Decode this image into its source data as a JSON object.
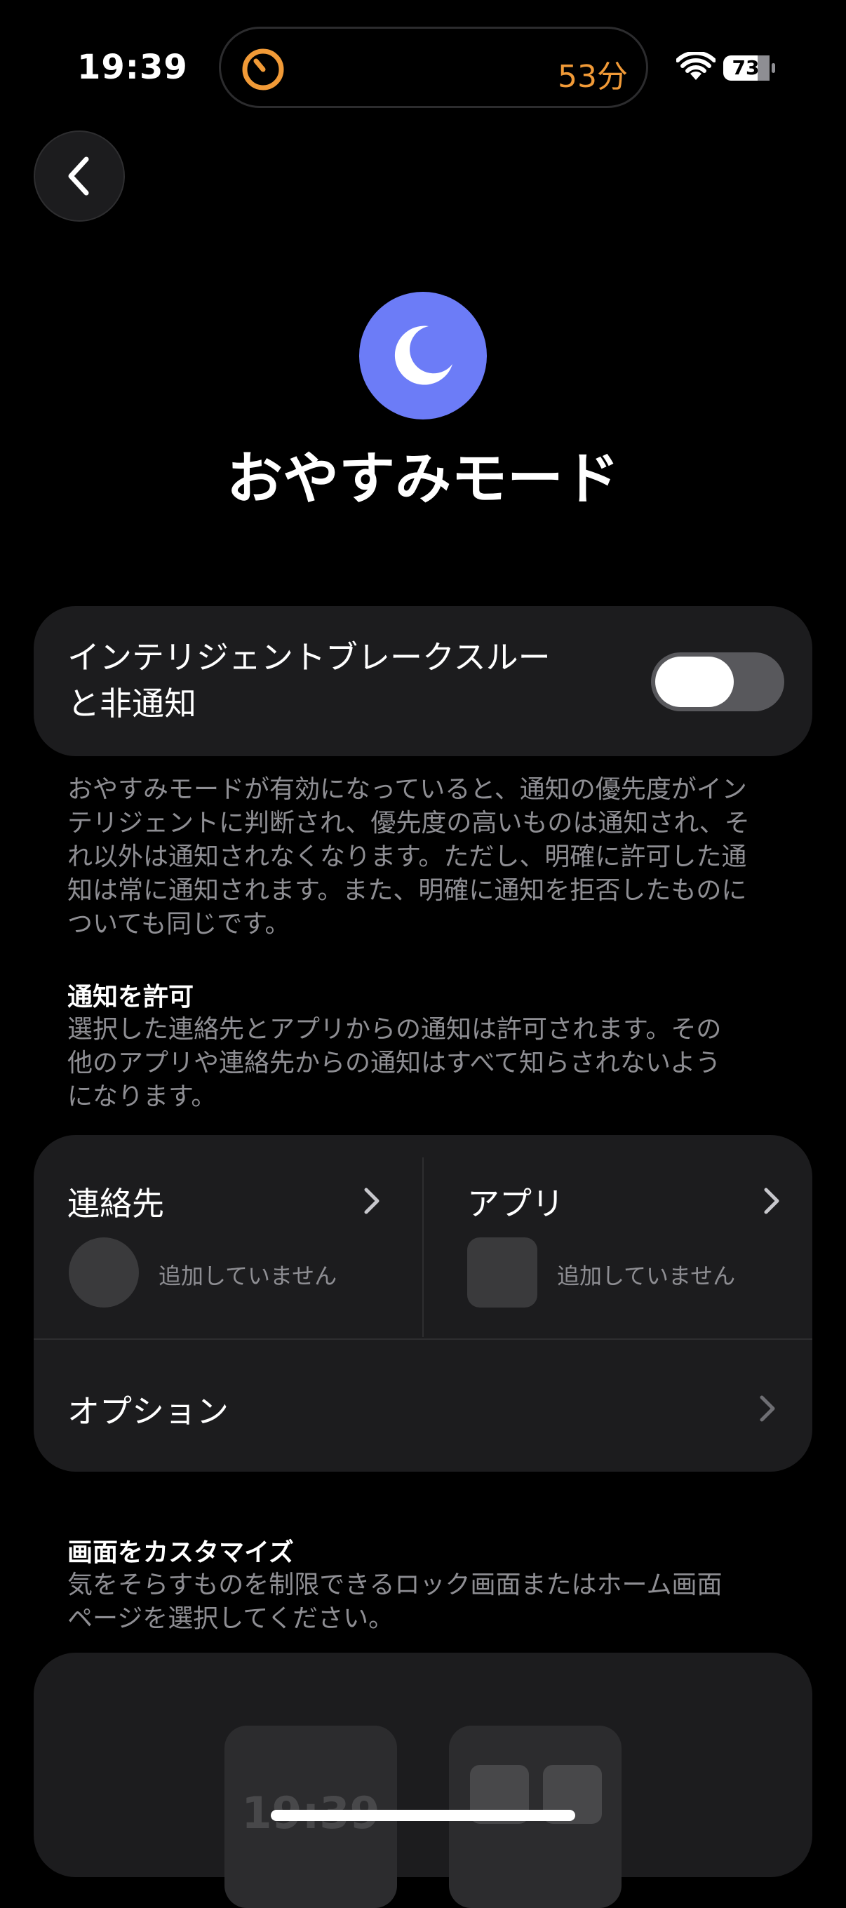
{
  "status_bar": {
    "time": "19:39",
    "timer": "53分",
    "battery": "73",
    "colors": {
      "timer_accent": "#f19a37"
    },
    "icons": [
      "timer-icon",
      "wifi-icon",
      "battery-icon"
    ]
  },
  "header": {
    "back_icon": "chevron-left-icon",
    "mode_icon": "moon-icon",
    "title": "おやすみモード",
    "accent": "#6c7cf7"
  },
  "intelligent": {
    "label_line1": "インテリジェントブレークスルー",
    "label_line2": "と非通知",
    "toggle_on": false,
    "description_lines": [
      "おやすみモードが有効になっていると、通知の優先度がイン",
      "テリジェントに判断され、優先度の高いものは通知され、そ",
      "れ以外は通知されなくなります。ただし、明確に許可した通",
      "知は常に通知されます。また、明確に通知を拒否したものに",
      "ついても同じです。"
    ]
  },
  "allow_notifications": {
    "title": "通知を許可",
    "description_lines": [
      "選択した連絡先とアプリからの通知は許可されます。その",
      "他のアプリや連絡先からの通知はすべて知らされないよう",
      "になります。"
    ],
    "contacts_label": "連絡先",
    "contacts_note": "追加していません",
    "apps_label": "アプリ",
    "apps_note": "追加していません",
    "options_label": "オプション"
  },
  "customize_screen": {
    "title": "画面をカスタマイズ",
    "description_lines": [
      "気をそらすものを制限できるロック画面またはホーム画面",
      "ページを選択してください。"
    ],
    "lock_preview_time": "19:39"
  }
}
